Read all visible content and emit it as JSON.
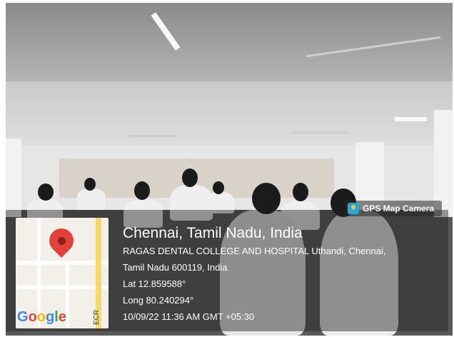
{
  "badge": {
    "label": "GPS Map Camera",
    "icon": "gps-map-camera-icon"
  },
  "location": {
    "city_line": "Chennai, Tamil Nadu, India",
    "address_line1": "RAGAS DENTAL COLLEGE AND HOSPITAL Uthandi, Chennai,",
    "address_line2": "Tamil Nadu 600119, India",
    "lat": "Lat 12.859588°",
    "long": "Long 80.240294°",
    "timestamp": "10/09/22 11:36 AM GMT +05:30"
  },
  "map": {
    "logo_text": "Google",
    "road_label": "ECR",
    "pin_icon": "map-pin-icon"
  },
  "colors": {
    "pin": "#e2403b",
    "google_blue": "#4285f4",
    "google_red": "#ea4335",
    "google_yellow": "#fbbc05",
    "google_green": "#34a853"
  }
}
